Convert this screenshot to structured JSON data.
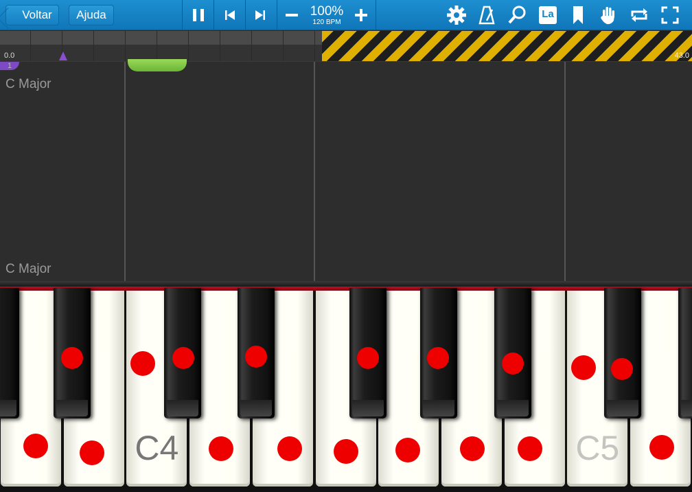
{
  "toolbar": {
    "back_label": "Voltar",
    "help_label": "Ajuda",
    "speed_percent": "100%",
    "speed_bpm": "120 BPM",
    "lang_label": "La",
    "icons": [
      "pause-icon",
      "skip-back-icon",
      "skip-forward-icon",
      "minus-icon",
      "plus-icon",
      "gear-icon",
      "metronome-icon",
      "zoom-icon",
      "note-names-icon",
      "bookmark-icon",
      "hand-icon",
      "loop-icon",
      "fullscreen-icon"
    ]
  },
  "timeline": {
    "start_time": "0.0",
    "end_time": "43.0"
  },
  "notes_area": {
    "key_signature_top": "C Major",
    "key_signature_bottom": "C Major",
    "measure_number": "1"
  },
  "keyboard": {
    "labels": {
      "c4": "C4",
      "c5": "C5"
    }
  },
  "colors": {
    "toolbar": "#1484c6",
    "marker": "#ee0000",
    "accent_red": "#c01022",
    "note_green": "#7fc447",
    "note_purple": "#7e49c4"
  }
}
